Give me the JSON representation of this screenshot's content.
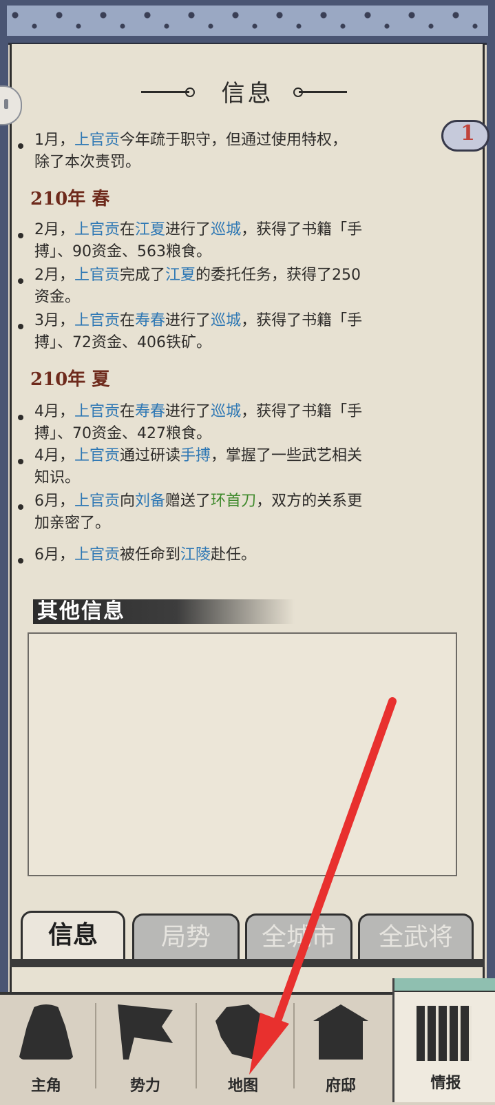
{
  "panel": {
    "title": "信息",
    "badge_count": "1"
  },
  "log": {
    "first_entry": [
      {
        "t": "1月，",
        "c": ""
      },
      {
        "t": "上官贡",
        "c": "n"
      },
      {
        "t": "今年疏于职守，但通过使用特权，",
        "c": ""
      },
      {
        "t": "除了本次责罚。",
        "c": "",
        "br": true
      }
    ],
    "sections": [
      {
        "season": "210年 春",
        "entries": [
          [
            {
              "t": "2月，",
              "c": ""
            },
            {
              "t": "上官贡",
              "c": "n"
            },
            {
              "t": "在",
              "c": ""
            },
            {
              "t": "江夏",
              "c": "n"
            },
            {
              "t": "进行了",
              "c": ""
            },
            {
              "t": "巡城",
              "c": "n"
            },
            {
              "t": "，获得了书籍「手",
              "c": ""
            },
            {
              "t": "搏」、90资金、563粮食。",
              "c": "",
              "br": true
            }
          ],
          [
            {
              "t": "2月，",
              "c": ""
            },
            {
              "t": "上官贡",
              "c": "n"
            },
            {
              "t": "完成了",
              "c": ""
            },
            {
              "t": "江夏",
              "c": "n"
            },
            {
              "t": "的委托任务，获得了250",
              "c": ""
            },
            {
              "t": "资金。",
              "c": "",
              "br": true
            }
          ],
          [
            {
              "t": "3月，",
              "c": ""
            },
            {
              "t": "上官贡",
              "c": "n"
            },
            {
              "t": "在",
              "c": ""
            },
            {
              "t": "寿春",
              "c": "n"
            },
            {
              "t": "进行了",
              "c": ""
            },
            {
              "t": "巡城",
              "c": "n"
            },
            {
              "t": "，获得了书籍「手",
              "c": ""
            },
            {
              "t": "搏」、72资金、406铁矿。",
              "c": "",
              "br": true
            }
          ]
        ]
      },
      {
        "season": "210年 夏",
        "entries": [
          [
            {
              "t": "4月，",
              "c": ""
            },
            {
              "t": "上官贡",
              "c": "n"
            },
            {
              "t": "在",
              "c": ""
            },
            {
              "t": "寿春",
              "c": "n"
            },
            {
              "t": "进行了",
              "c": ""
            },
            {
              "t": "巡城",
              "c": "n"
            },
            {
              "t": "，获得了书籍「手",
              "c": ""
            },
            {
              "t": "搏」、70资金、427粮食。",
              "c": "",
              "br": true
            }
          ],
          [
            {
              "t": "4月，",
              "c": ""
            },
            {
              "t": "上官贡",
              "c": "n"
            },
            {
              "t": "通过研读",
              "c": ""
            },
            {
              "t": "手搏",
              "c": "n"
            },
            {
              "t": "，掌握了一些武艺相关",
              "c": ""
            },
            {
              "t": "知识。",
              "c": "",
              "br": true
            }
          ],
          [
            {
              "t": "6月，",
              "c": ""
            },
            {
              "t": "上官贡",
              "c": "n"
            },
            {
              "t": "向",
              "c": ""
            },
            {
              "t": "刘备",
              "c": "n"
            },
            {
              "t": "赠送了",
              "c": ""
            },
            {
              "t": "环首刀",
              "c": "g"
            },
            {
              "t": "，双方的关系更",
              "c": ""
            },
            {
              "t": "加亲密了。",
              "c": "",
              "br": true
            }
          ],
          [
            {
              "t": "6月，",
              "c": ""
            },
            {
              "t": "上官贡",
              "c": "n"
            },
            {
              "t": "被任命到",
              "c": ""
            },
            {
              "t": "江陵",
              "c": "n"
            },
            {
              "t": "赴任。",
              "c": ""
            }
          ]
        ]
      }
    ]
  },
  "other_info": {
    "title": "其他信息"
  },
  "tabs": [
    {
      "label": "信息",
      "active": true
    },
    {
      "label": "局势",
      "active": false
    },
    {
      "label": "全城市",
      "active": false
    },
    {
      "label": "全武将",
      "active": false
    }
  ],
  "nav": [
    {
      "label": "主角",
      "icon": "character-icon"
    },
    {
      "label": "势力",
      "icon": "flag-icon"
    },
    {
      "label": "地图",
      "icon": "map-icon"
    },
    {
      "label": "府邸",
      "icon": "mansion-icon"
    },
    {
      "label": "情报",
      "icon": "scroll-book-icon"
    }
  ],
  "colors": {
    "name_blue": "#2f78b4",
    "item_green": "#3f8a2c",
    "season_red": "#6e2a1c",
    "annotation_arrow": "#e8302e"
  }
}
